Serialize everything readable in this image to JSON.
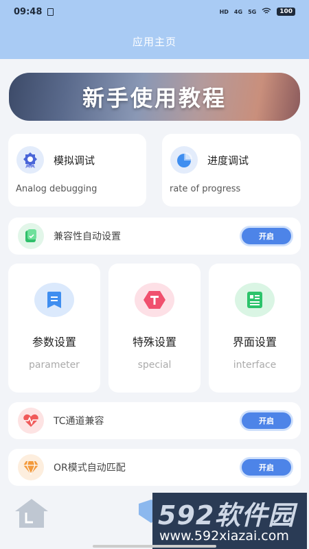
{
  "status_bar": {
    "time": "09:48",
    "signal_hd": "HD",
    "signal_4g": "4G",
    "signal_5g": "5G",
    "battery": "100"
  },
  "header": {
    "title": "应用主页"
  },
  "banner": {
    "text": "新手使用教程"
  },
  "top_cards": [
    {
      "title": "模拟调试",
      "subtitle": "Analog debugging",
      "icon": "ribbon-award-icon"
    },
    {
      "title": "进度调试",
      "subtitle": "rate of progress",
      "icon": "pie-chart-icon"
    }
  ],
  "compat_row": {
    "label": "兼容性自动设置",
    "toggle": "开启",
    "icon": "phone-settings-icon"
  },
  "grid": [
    {
      "title": "参数设置",
      "subtitle": "parameter",
      "icon": "bookmark-doc-icon",
      "color": "#3f8ef0"
    },
    {
      "title": "特殊设置",
      "subtitle": "special",
      "icon": "hexagon-t-icon",
      "color": "#f0506e"
    },
    {
      "title": "界面设置",
      "subtitle": "interface",
      "icon": "document-list-icon",
      "color": "#2cc36b"
    }
  ],
  "rows": [
    {
      "label": "TC通道兼容",
      "toggle": "开启",
      "icon": "heartbeat-icon"
    },
    {
      "label": "OR模式自动匹配",
      "toggle": "开启",
      "icon": "diamond-icon"
    }
  ],
  "watermark": {
    "brand": "592软件园",
    "url": "www.592xiazai.com"
  },
  "colors": {
    "header": "#a9cbf4",
    "toggle": "#4d84e8",
    "background": "#f2f4f8"
  }
}
